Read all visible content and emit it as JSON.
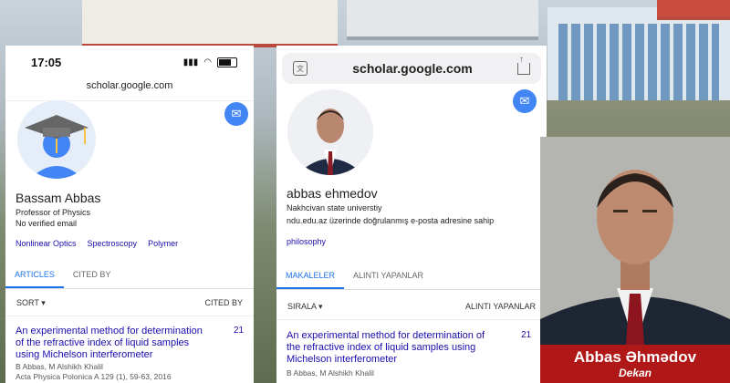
{
  "phone1": {
    "status_time": "17:05",
    "url": "scholar.google.com",
    "profile": {
      "name": "Bassam Abbas",
      "title": "Professor of Physics",
      "email_status": "No verified email",
      "interests": [
        "Nonlinear Optics",
        "Spectroscopy",
        "Polymer"
      ]
    },
    "tabs": [
      "ARTICLES",
      "CITED BY"
    ],
    "sort_label": "SORT",
    "cited_by_label": "CITED BY",
    "article": {
      "title": "An experimental method for determination of the refractive index of liquid samples using Michelson interferometer",
      "citations": "21",
      "authors": "B Abbas, M Alshikh Khalil",
      "venue": "Acta Physica Polonica A 129 (1), 59-63, 2016"
    }
  },
  "phone2": {
    "url": "scholar.google.com",
    "profile": {
      "name": "abbas ehmedov",
      "affiliation": "Nakhcivan state universtiy",
      "email_status": "ndu.edu.az üzerinde doğrulanmış e-posta adresine sahip",
      "interests": [
        "philosophy"
      ]
    },
    "tabs": [
      "MAKALELER",
      "ALINTI YAPANLAR"
    ],
    "sort_label": "SIRALA",
    "cited_by_label": "ALINTI YAPANLAR",
    "article": {
      "title": "An experimental method for determination of the refractive index of liquid samples using Michelson interferometer",
      "citations": "21",
      "authors": "B Abbas, M Alshikh Khalil"
    }
  },
  "nameplate": {
    "name": "Abbas Əhmədov",
    "title": "Dekan"
  },
  "colors": {
    "link_blue": "#1a0dab",
    "tab_blue": "#1a73e8",
    "nameplate_red": "#b01717"
  }
}
